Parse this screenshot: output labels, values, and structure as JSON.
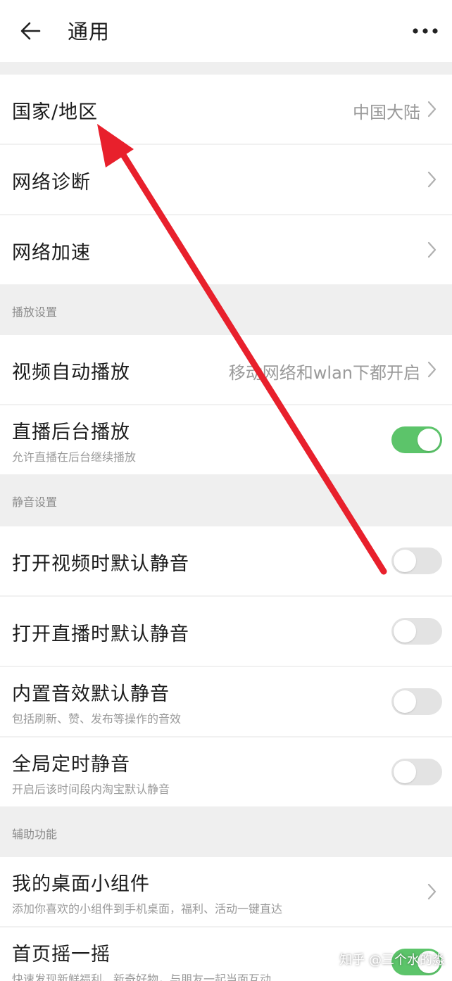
{
  "header": {
    "title": "通用"
  },
  "rows": [
    {
      "label": "国家/地区",
      "value": "中国大陆"
    },
    {
      "label": "网络诊断"
    },
    {
      "label": "网络加速"
    }
  ],
  "sections": {
    "playback": {
      "title": "播放设置"
    },
    "mute": {
      "title": "静音设置"
    },
    "assist": {
      "title": "辅助功能"
    }
  },
  "playback_rows": [
    {
      "label": "视频自动播放",
      "value": "移动网络和wlan下都开启"
    },
    {
      "label": "直播后台播放",
      "sub": "允许直播在后台继续播放",
      "toggle": true
    }
  ],
  "mute_rows": [
    {
      "label": "打开视频时默认静音",
      "toggle": false
    },
    {
      "label": "打开直播时默认静音",
      "toggle": false
    },
    {
      "label": "内置音效默认静音",
      "sub": "包括刷新、赞、发布等操作的音效",
      "toggle": false
    },
    {
      "label": "全局定时静音",
      "sub": "开启后该时间段内淘宝默认静音",
      "toggle": false
    }
  ],
  "assist_rows": [
    {
      "label": "我的桌面小组件",
      "sub": "添加你喜欢的小组件到手机桌面，福利、活动一键直达"
    },
    {
      "label": "首页摇一摇",
      "sub": "快速发现新鲜福利、新奇好物，与朋友一起当面互动",
      "toggle": true
    }
  ],
  "watermark": "知乎 @三个水的淼",
  "colors": {
    "toggle_on": "#5cc46a",
    "toggle_off": "#e3e3e3",
    "arrow": "#e8202c"
  },
  "icons": {
    "back": "back-arrow-icon",
    "more": "more-dots-icon",
    "chevron": "chevron-right-icon"
  }
}
